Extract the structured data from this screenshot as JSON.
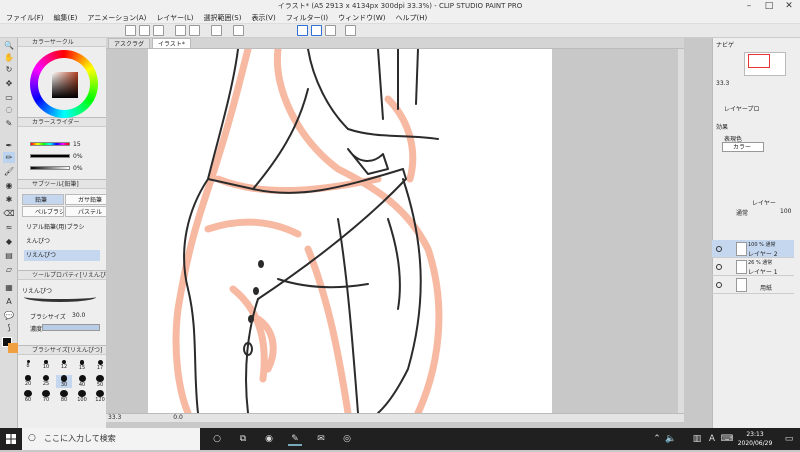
{
  "title": "イラスト* (A5 2913 x 4134px 300dpi 33.3%) - CLIP STUDIO PAINT PRO",
  "menus": [
    "ファイル(F)",
    "編集(E)",
    "アニメーション(A)",
    "レイヤー(L)",
    "選択範囲(S)",
    "表示(V)",
    "フィルター(I)",
    "ウィンドウ(W)",
    "ヘルプ(H)"
  ],
  "window_controls": {
    "minimize": "–",
    "maximize": "□",
    "close": "✕"
  },
  "doc_tabs": [
    "アスクラグ",
    "イラスト*"
  ],
  "panels": {
    "color_wheel": "カラーサークル",
    "color_slider": "カラースライダー",
    "sub_tool": "サブツール[鉛筆]",
    "tool_property": "ツールプロパティ[リえんぴつ]",
    "brush_size": "ブラシサイズ[リえんぴつ]"
  },
  "color_values": {
    "h": "15",
    "s": "0%",
    "v": "0%"
  },
  "subtool_buttons": [
    "鉛筆",
    "ガサ鉛筆",
    "ペルブラシ",
    "パステル"
  ],
  "subtool_strokes": [
    "リアル鉛筆(用)ブラシ",
    "えんぴつ",
    "リえんぴつ"
  ],
  "tool_property": {
    "current": "リえんぴつ",
    "size_label": "ブラシサイズ",
    "size_value": "30.0",
    "density_label": "濃度"
  },
  "brush_sizes": [
    "8",
    "10",
    "12",
    "15",
    "17",
    "20",
    "25",
    "30",
    "40",
    "50",
    "60",
    "70",
    "80",
    "100",
    "120"
  ],
  "brush_selected": "30",
  "right_panel": {
    "nav_tab": "ナビゲ",
    "zoom": "33.3",
    "layer_prop_tab": "レイヤープロ",
    "effect_label": "効果",
    "expr_label": "表現色",
    "expr_value": "カラー",
    "layer_tab": "レイヤー",
    "blend_mode": "通常",
    "opacity": "100"
  },
  "layers": [
    {
      "mode": "100 % 通常",
      "name": "レイヤー 2",
      "selected": true
    },
    {
      "mode": "26 % 通常",
      "name": "レイヤー 1",
      "selected": false
    },
    {
      "mode": "",
      "name": "用紙",
      "selected": false
    }
  ],
  "status": {
    "zoom": "33.3",
    "angle": "0.0"
  },
  "taskbar": {
    "search_placeholder": "ここに入力して検索",
    "time": "23:13",
    "date": "2020/06/29",
    "lang": "A"
  },
  "colors": {
    "sketch": "#f7b9a2",
    "ink": "#2b2b2b",
    "accent": "#2f6fd6",
    "fg": "#111111",
    "bg": "#f0a040"
  }
}
